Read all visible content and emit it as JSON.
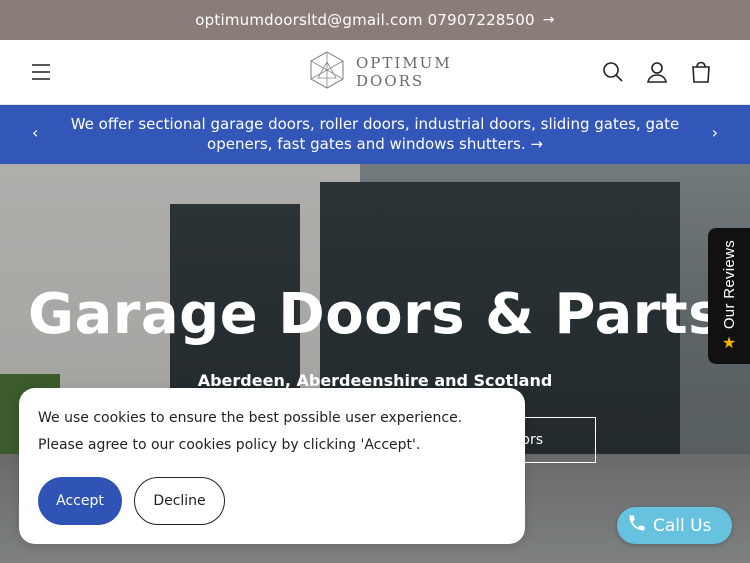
{
  "topbar": {
    "text": "optimumdoorsltd@gmail.com 07907228500",
    "arrow": "→"
  },
  "header": {
    "logo_line1": "OPTIMUM",
    "logo_line2": "DOORS",
    "icons": [
      "menu-icon",
      "search-icon",
      "account-icon",
      "cart-icon"
    ]
  },
  "announcement": {
    "text": "We offer sectional garage doors, roller  doors,  industrial doors, sliding gates, gate openers, fast gates and windows shutters. →",
    "prev": "‹",
    "next": "›"
  },
  "hero": {
    "title": "Garage Doors & Parts",
    "subtitle": "Aberdeen, Aberdeenshire and Scotland",
    "button_label": "ors"
  },
  "reviews_tab": {
    "label": "Our Reviews",
    "star": "★"
  },
  "cookie": {
    "message": "We use cookies to ensure the best possible user experience. Please agree to our cookies policy by clicking 'Accept'.",
    "accept_label": "Accept",
    "decline_label": "Decline"
  },
  "call_us": {
    "label": "Call Us"
  },
  "colors": {
    "topbar": "#8a7d78",
    "announcement": "#3357b8",
    "accept": "#2f54b5",
    "call_us": "#67c2df",
    "star": "#f5b301"
  }
}
